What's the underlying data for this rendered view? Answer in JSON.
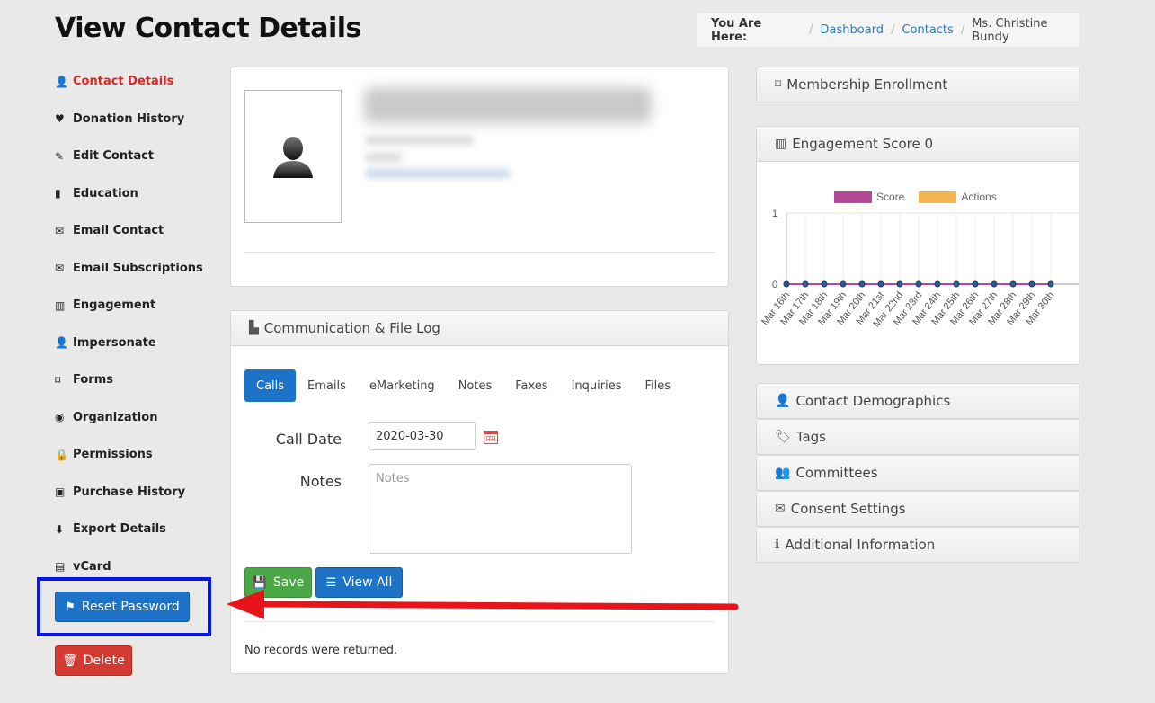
{
  "page_title": "View Contact Details",
  "breadcrumb": {
    "label": "You Are Here:",
    "items": [
      "Dashboard",
      "Contacts"
    ],
    "current": "Ms. Christine Bundy"
  },
  "sidebar": {
    "items": [
      {
        "label": "Contact Details",
        "icon": "user-icon",
        "glyph": "👤",
        "active": true
      },
      {
        "label": "Donation History",
        "icon": "heart-icon",
        "glyph": "♥"
      },
      {
        "label": "Edit Contact",
        "icon": "edit-icon",
        "glyph": "✎"
      },
      {
        "label": "Education",
        "icon": "book-icon",
        "glyph": "▮"
      },
      {
        "label": "Email Contact",
        "icon": "envelope-icon",
        "glyph": "✉"
      },
      {
        "label": "Email Subscriptions",
        "icon": "envelope-icon",
        "glyph": "✉"
      },
      {
        "label": "Engagement",
        "icon": "bar-chart-icon",
        "glyph": "▥"
      },
      {
        "label": "Impersonate",
        "icon": "user-icon",
        "glyph": "👤"
      },
      {
        "label": "Forms",
        "icon": "bookmark-icon",
        "glyph": "⌑"
      },
      {
        "label": "Organization",
        "icon": "eye-icon",
        "glyph": "◉"
      },
      {
        "label": "Permissions",
        "icon": "lock-icon",
        "glyph": "🔒"
      },
      {
        "label": "Purchase History",
        "icon": "money-icon",
        "glyph": "▣"
      },
      {
        "label": "Export Details",
        "icon": "download-icon",
        "glyph": "⬇"
      },
      {
        "label": "vCard",
        "icon": "card-icon",
        "glyph": "▤"
      }
    ],
    "reset_label": "Reset Password",
    "delete_label": "Delete"
  },
  "log_panel": {
    "title": "Communication & File Log",
    "tabs": [
      "Calls",
      "Emails",
      "eMarketing",
      "Notes",
      "Faxes",
      "Inquiries",
      "Files"
    ],
    "active_tab": "Calls",
    "call_date_label": "Call Date",
    "call_date_value": "2020-03-30",
    "notes_label": "Notes",
    "notes_placeholder": "Notes",
    "save_label": "Save",
    "view_all_label": "View All",
    "no_records": "No records were returned."
  },
  "right": {
    "membership": "Membership Enrollment",
    "engagement_title": "Engagement Score 0",
    "accordion": [
      {
        "label": "Contact Demographics",
        "icon": "user-icon",
        "glyph": "👤"
      },
      {
        "label": "Tags",
        "icon": "tags-icon",
        "glyph": "🏷"
      },
      {
        "label": "Committees",
        "icon": "users-icon",
        "glyph": "👥"
      },
      {
        "label": "Consent Settings",
        "icon": "envelope-icon",
        "glyph": "✉"
      },
      {
        "label": "Additional Information",
        "icon": "info-icon",
        "glyph": "ℹ"
      }
    ]
  },
  "chart_data": {
    "type": "line",
    "categories": [
      "Mar 16th",
      "Mar 17th",
      "Mar 18th",
      "Mar 19th",
      "Mar 20th",
      "Mar 21st",
      "Mar 22nd",
      "Mar 23rd",
      "Mar 24th",
      "Mar 25th",
      "Mar 26th",
      "Mar 27th",
      "Mar 28th",
      "Mar 29th",
      "Mar 30th"
    ],
    "series": [
      {
        "name": "Score",
        "color": "#b44a97",
        "values": [
          0,
          0,
          0,
          0,
          0,
          0,
          0,
          0,
          0,
          0,
          0,
          0,
          0,
          0,
          0
        ]
      },
      {
        "name": "Actions",
        "color": "#f3b54e",
        "values": [
          0,
          0,
          0,
          0,
          0,
          0,
          0,
          0,
          0,
          0,
          0,
          0,
          0,
          0,
          0
        ]
      }
    ],
    "ylim": [
      0,
      1
    ],
    "yticks": [
      "0",
      "1"
    ],
    "grid": true,
    "legend": "top"
  }
}
